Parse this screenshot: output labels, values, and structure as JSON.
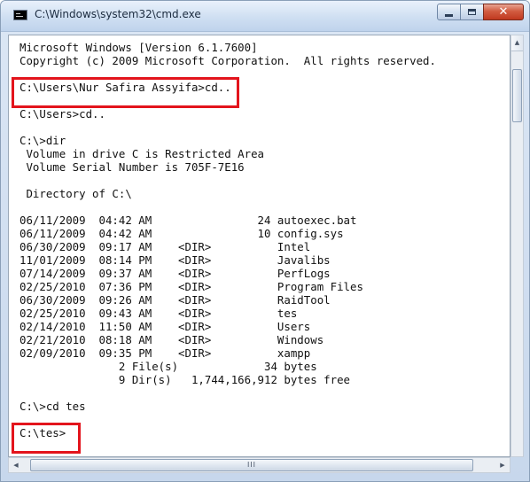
{
  "window": {
    "title": "C:\\Windows\\system32\\cmd.exe",
    "icon": "cmd-icon",
    "buttons": {
      "minimize": "minimize-icon",
      "maximize": "maximize-icon",
      "close_label": "✕"
    }
  },
  "console": {
    "lines": [
      "Microsoft Windows [Version 6.1.7600]",
      "Copyright (c) 2009 Microsoft Corporation.  All rights reserved.",
      "",
      "C:\\Users\\Nur Safira Assyifa>cd..",
      "",
      "C:\\Users>cd..",
      "",
      "C:\\>dir",
      " Volume in drive C is Restricted Area",
      " Volume Serial Number is 705F-7E16",
      "",
      " Directory of C:\\",
      "",
      "06/11/2009  04:42 AM                24 autoexec.bat",
      "06/11/2009  04:42 AM                10 config.sys",
      "06/30/2009  09:17 AM    <DIR>          Intel",
      "11/01/2009  08:14 PM    <DIR>          Javalibs",
      "07/14/2009  09:37 AM    <DIR>          PerfLogs",
      "02/25/2010  07:36 PM    <DIR>          Program Files",
      "06/30/2009  09:26 AM    <DIR>          RaidTool",
      "02/25/2010  09:43 AM    <DIR>          tes",
      "02/14/2010  11:50 AM    <DIR>          Users",
      "02/21/2010  08:18 AM    <DIR>          Windows",
      "02/09/2010  09:35 PM    <DIR>          xampp",
      "               2 File(s)             34 bytes",
      "               9 Dir(s)   1,744,166,912 bytes free",
      "",
      "C:\\>cd tes",
      "",
      "C:\\tes>"
    ]
  },
  "scrollbars": {
    "up_arrow": "▲",
    "left_arrow": "◀",
    "right_arrow": "▶",
    "thumb_grip": "III"
  },
  "colors": {
    "highlight": "#e3141c",
    "console_background": "#ffffff",
    "console_text": "#111111"
  }
}
